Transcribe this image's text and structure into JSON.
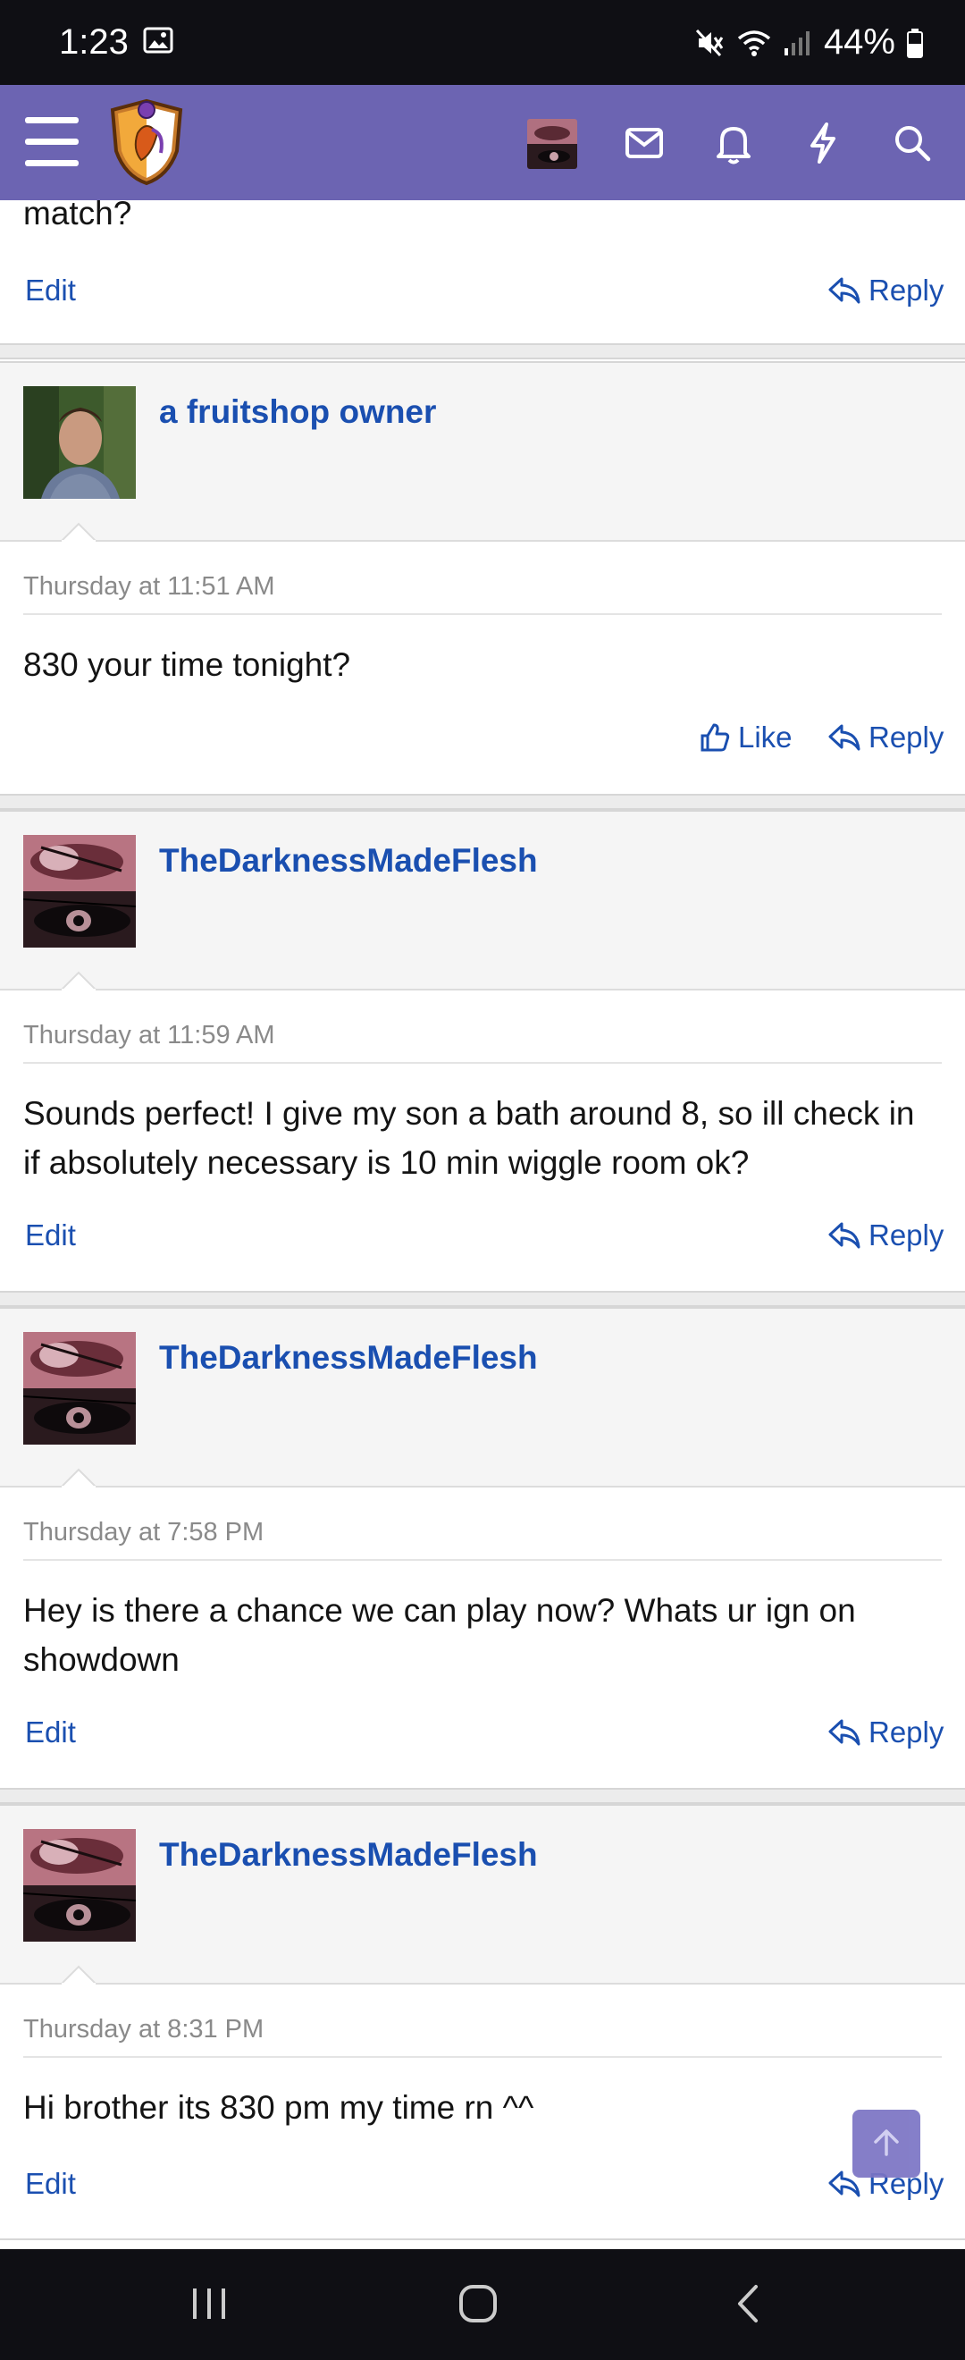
{
  "status_bar": {
    "time": "1:23",
    "battery": "44%",
    "icons": [
      "image-icon",
      "mute-icon",
      "wifi-icon",
      "signal-icon",
      "battery-icon"
    ]
  },
  "header": {
    "icons": [
      "menu-icon",
      "site-logo",
      "user-avatar",
      "mail-icon",
      "bell-icon",
      "bolt-icon",
      "search-icon"
    ],
    "accent": "#6c64b2"
  },
  "posts": [
    {
      "partial": true,
      "body": "match?",
      "actions": {
        "edit": "Edit",
        "reply": "Reply"
      }
    },
    {
      "username": "a fruitshop owner",
      "date": "Thursday at 11:51 AM",
      "body": "830 your time tonight?",
      "actions": {
        "like": "Like",
        "reply": "Reply"
      }
    },
    {
      "username": "TheDarknessMadeFlesh",
      "date": "Thursday at 11:59 AM",
      "body": "Sounds perfect! I give my son a bath around 8, so ill check in if absolutely necessary is 10 min wiggle room ok?",
      "actions": {
        "edit": "Edit",
        "reply": "Reply"
      }
    },
    {
      "username": "TheDarknessMadeFlesh",
      "date": "Thursday at 7:58 PM",
      "body": "Hey is there a chance we can play now? Whats ur ign on showdown",
      "actions": {
        "edit": "Edit",
        "reply": "Reply"
      }
    },
    {
      "username": "TheDarknessMadeFlesh",
      "date": "Thursday at 8:31 PM",
      "body": "Hi brother its 830 pm my time rn ^^",
      "actions": {
        "edit": "Edit",
        "reply": "Reply"
      }
    }
  ],
  "colors": {
    "link": "#1a4fb0",
    "muted": "#8a8a8a",
    "header_bg": "#6c64b2"
  }
}
